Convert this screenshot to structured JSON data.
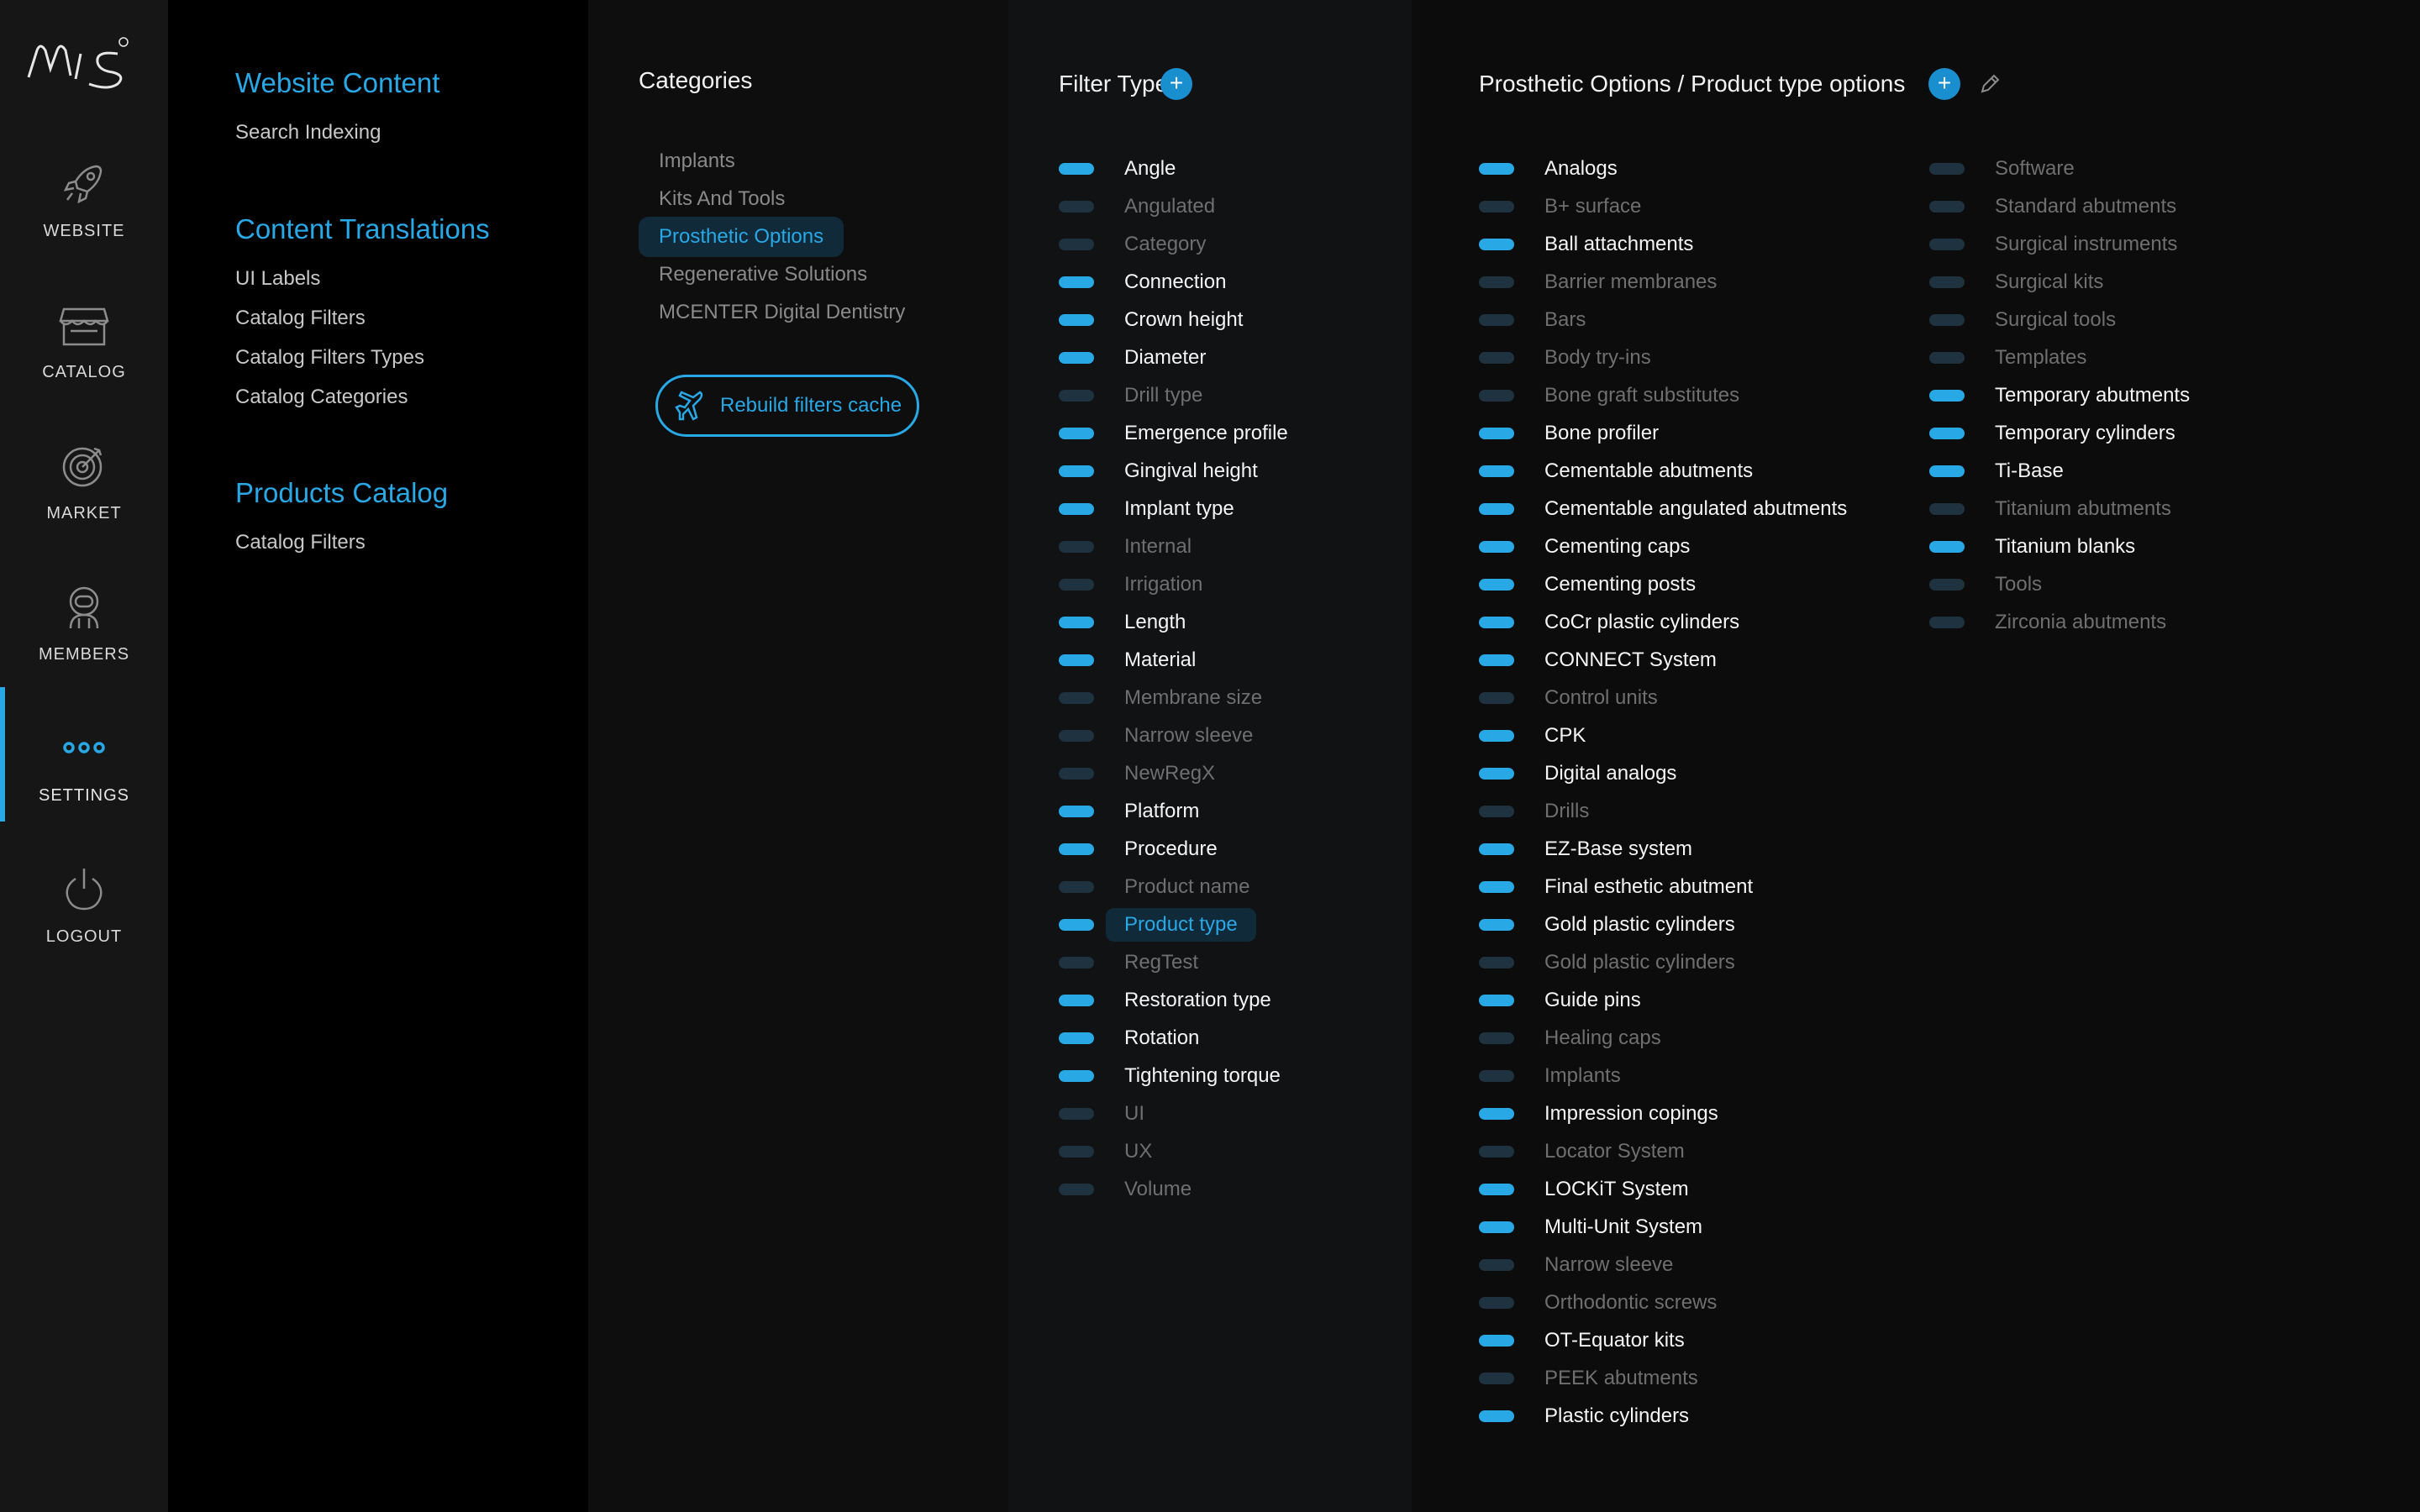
{
  "brand": {
    "logo_text": "mis",
    "registered": "®"
  },
  "nav": {
    "items": [
      {
        "label": "WEBSITE",
        "icon": "rocket-icon"
      },
      {
        "label": "CATALOG",
        "icon": "store-icon"
      },
      {
        "label": "MARKET",
        "icon": "market-icon"
      },
      {
        "label": "MEMBERS",
        "icon": "members-icon"
      },
      {
        "label": "SETTINGS",
        "icon": "ellipsis-icon",
        "active": true
      },
      {
        "label": "LOGOUT",
        "icon": "power-icon"
      }
    ],
    "accent": "#29a8e6"
  },
  "settings_menu": {
    "website_content": {
      "title": "Website Content",
      "links": [
        "Search Indexing"
      ]
    },
    "content_translations": {
      "title": "Content Translations",
      "links": [
        "UI Labels",
        "Catalog Filters",
        "Catalog Filters Types",
        "Catalog Categories"
      ]
    },
    "products_catalog": {
      "title": "Products Catalog",
      "links": [
        "Catalog Filters"
      ]
    }
  },
  "categories": {
    "title": "Categories",
    "items": [
      "Implants",
      "Kits And Tools",
      "Prosthetic Options",
      "Regenerative Solutions",
      "MCENTER Digital Dentistry"
    ],
    "selected": "Prosthetic Options",
    "rebuild_label": "Rebuild filters cache"
  },
  "filter_types": {
    "title": "Filter Types",
    "add_label": "+",
    "items": [
      {
        "label": "Angle",
        "on": true
      },
      {
        "label": "Angulated",
        "on": false
      },
      {
        "label": "Category",
        "on": false
      },
      {
        "label": "Connection",
        "on": true
      },
      {
        "label": "Crown height",
        "on": true
      },
      {
        "label": "Diameter",
        "on": true
      },
      {
        "label": "Drill type",
        "on": false
      },
      {
        "label": "Emergence profile",
        "on": true
      },
      {
        "label": "Gingival height",
        "on": true
      },
      {
        "label": "Implant type",
        "on": true
      },
      {
        "label": "Internal",
        "on": false
      },
      {
        "label": "Irrigation",
        "on": false
      },
      {
        "label": "Length",
        "on": true
      },
      {
        "label": "Material",
        "on": true
      },
      {
        "label": "Membrane size",
        "on": false
      },
      {
        "label": "Narrow sleeve",
        "on": false
      },
      {
        "label": "NewRegX",
        "on": false
      },
      {
        "label": "Platform",
        "on": true
      },
      {
        "label": "Procedure",
        "on": true
      },
      {
        "label": "Product name",
        "on": false
      },
      {
        "label": "Product type",
        "on": true,
        "selected": true
      },
      {
        "label": "RegTest",
        "on": false
      },
      {
        "label": "Restoration type",
        "on": true
      },
      {
        "label": "Rotation",
        "on": true
      },
      {
        "label": "Tightening torque",
        "on": true
      },
      {
        "label": "UI",
        "on": false
      },
      {
        "label": "UX",
        "on": false
      },
      {
        "label": "Volume",
        "on": false
      }
    ]
  },
  "options": {
    "title": "Prosthetic Options / Product type options",
    "add_label": "+",
    "col1": [
      {
        "label": "Analogs",
        "on": true
      },
      {
        "label": "B+ surface",
        "on": false
      },
      {
        "label": "Ball attachments",
        "on": true
      },
      {
        "label": "Barrier membranes",
        "on": false
      },
      {
        "label": "Bars",
        "on": false
      },
      {
        "label": "Body try-ins",
        "on": false
      },
      {
        "label": "Bone graft substitutes",
        "on": false
      },
      {
        "label": "Bone profiler",
        "on": true
      },
      {
        "label": "Cementable abutments",
        "on": true
      },
      {
        "label": "Cementable angulated abutments",
        "on": true
      },
      {
        "label": "Cementing caps",
        "on": true
      },
      {
        "label": "Cementing posts",
        "on": true
      },
      {
        "label": "CoCr plastic cylinders",
        "on": true
      },
      {
        "label": "CONNECT System",
        "on": true
      },
      {
        "label": "Control units",
        "on": false
      },
      {
        "label": "CPK",
        "on": true
      },
      {
        "label": "Digital analogs",
        "on": true
      },
      {
        "label": "Drills",
        "on": false
      },
      {
        "label": "EZ-Base system",
        "on": true
      },
      {
        "label": "Final esthetic abutment",
        "on": true
      },
      {
        "label": "Gold plastic cylinders",
        "on": true
      },
      {
        "label": "Gold plastic cylinders",
        "on": false
      },
      {
        "label": "Guide pins",
        "on": true
      },
      {
        "label": "Healing caps",
        "on": false
      },
      {
        "label": "Implants",
        "on": false
      },
      {
        "label": "Impression copings",
        "on": true
      },
      {
        "label": "Locator System",
        "on": false
      },
      {
        "label": "LOCKiT System",
        "on": true
      },
      {
        "label": "Multi-Unit System",
        "on": true
      },
      {
        "label": "Narrow sleeve",
        "on": false
      },
      {
        "label": "Orthodontic screws",
        "on": false
      },
      {
        "label": "OT-Equator kits",
        "on": true
      },
      {
        "label": "PEEK abutments",
        "on": false
      },
      {
        "label": "Plastic cylinders",
        "on": true
      }
    ],
    "col2": [
      {
        "label": "Software",
        "on": false
      },
      {
        "label": "Standard abutments",
        "on": false
      },
      {
        "label": "Surgical instruments",
        "on": false
      },
      {
        "label": "Surgical kits",
        "on": false
      },
      {
        "label": "Surgical tools",
        "on": false
      },
      {
        "label": "Templates",
        "on": false
      },
      {
        "label": "Temporary abutments",
        "on": true
      },
      {
        "label": "Temporary cylinders",
        "on": true
      },
      {
        "label": "Ti-Base",
        "on": true
      },
      {
        "label": "Titanium abutments",
        "on": false
      },
      {
        "label": "Titanium blanks",
        "on": true
      },
      {
        "label": "Tools",
        "on": false
      },
      {
        "label": "Zirconia abutments",
        "on": false
      }
    ]
  }
}
